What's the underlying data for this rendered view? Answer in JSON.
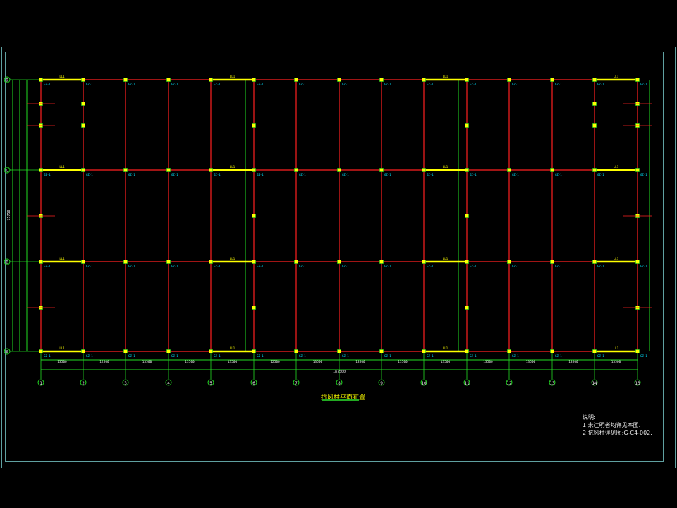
{
  "drawing": {
    "title": "抗风柱平面布置",
    "notes_heading": "说明:",
    "note_1": "1.未注明者均详见本图.",
    "note_2": "2.抗风柱详见图:G-C4-002.",
    "overall_dimension": "187500",
    "left_overall_dimension": "75750"
  },
  "grid_columns": [
    "1",
    "2",
    "3",
    "4",
    "5",
    "6",
    "7",
    "8",
    "9",
    "10",
    "11",
    "12",
    "13",
    "14",
    "15"
  ],
  "grid_rows": [
    "D",
    "C",
    "B",
    "A"
  ],
  "bay_dimensions": [
    "13500",
    "12500",
    "13500",
    "13500",
    "13500",
    "12500",
    "13500",
    "13500",
    "13500",
    "13500",
    "13500",
    "13500",
    "13500",
    "13500"
  ],
  "column_tag": "GZ-1",
  "beam_tag": "LL1",
  "colors": {
    "beam_red": "#ff2020",
    "grid_green": "#22dd22",
    "highlight_yellow": "#ffff00",
    "tag_cyan": "#00e5ff",
    "frame": "#5fa0a0"
  }
}
